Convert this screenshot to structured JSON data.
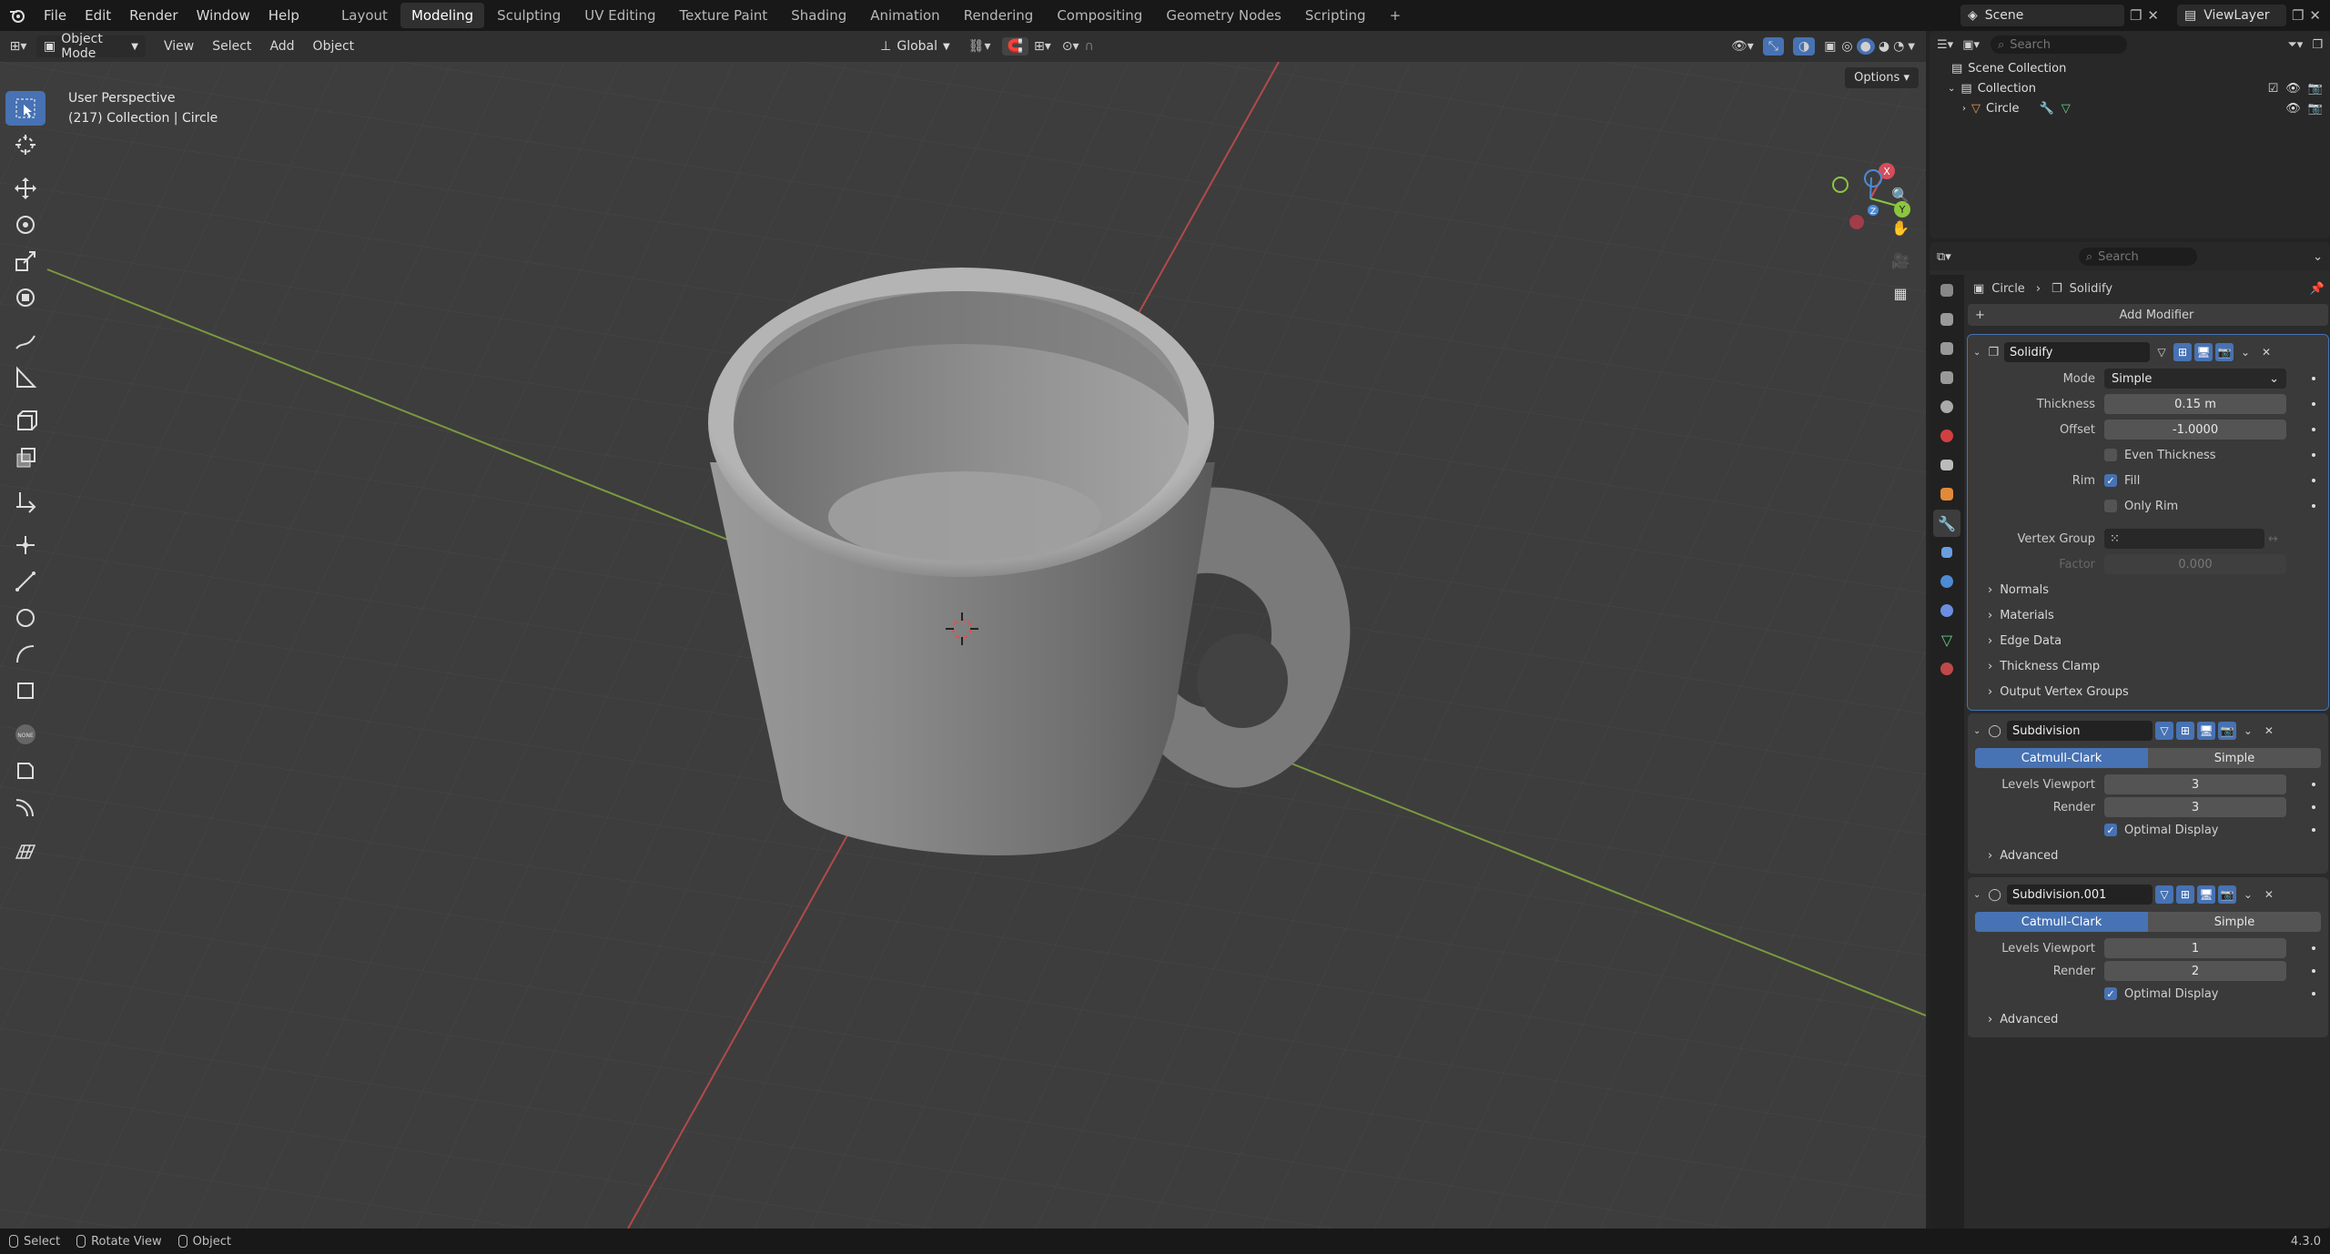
{
  "topbar": {
    "menus": [
      "File",
      "Edit",
      "Render",
      "Window",
      "Help"
    ],
    "workspaces": [
      "Layout",
      "Modeling",
      "Sculpting",
      "UV Editing",
      "Texture Paint",
      "Shading",
      "Animation",
      "Rendering",
      "Compositing",
      "Geometry Nodes",
      "Scripting"
    ],
    "active_workspace": "Modeling",
    "scene": "Scene",
    "view_layer": "ViewLayer"
  },
  "viewport_header": {
    "mode": "Object Mode",
    "menus": [
      "View",
      "Select",
      "Add",
      "Object"
    ],
    "orientation": "Global",
    "options": "Options"
  },
  "viewport": {
    "perspective": "User Perspective",
    "collection_info": "(217) Collection | Circle",
    "gizmo": {
      "x": "X",
      "y": "Y",
      "z": "Z"
    }
  },
  "outliner": {
    "search_placeholder": "Search",
    "scene_collection": "Scene Collection",
    "collection": "Collection",
    "object": "Circle"
  },
  "properties": {
    "search_placeholder": "Search",
    "breadcrumb_object": "Circle",
    "breadcrumb_modifier": "Solidify",
    "add_modifier": "Add Modifier",
    "solidify": {
      "name": "Solidify",
      "mode_label": "Mode",
      "mode_value": "Simple",
      "thickness_label": "Thickness",
      "thickness_value": "0.15 m",
      "offset_label": "Offset",
      "offset_value": "-1.0000",
      "even_thickness": "Even Thickness",
      "rim_label": "Rim",
      "fill": "Fill",
      "only_rim": "Only Rim",
      "vertex_group_label": "Vertex Group",
      "factor_label": "Factor",
      "factor_value": "0.000",
      "subpanels": [
        "Normals",
        "Materials",
        "Edge Data",
        "Thickness Clamp",
        "Output Vertex Groups"
      ]
    },
    "subdivision": {
      "name": "Subdivision",
      "catmull": "Catmull-Clark",
      "simple": "Simple",
      "levels_label": "Levels Viewport",
      "levels_value": "3",
      "render_label": "Render",
      "render_value": "3",
      "optimal": "Optimal Display",
      "advanced": "Advanced"
    },
    "subdivision2": {
      "name": "Subdivision.001",
      "catmull": "Catmull-Clark",
      "simple": "Simple",
      "levels_label": "Levels Viewport",
      "levels_value": "1",
      "render_label": "Render",
      "render_value": "2",
      "optimal": "Optimal Display",
      "advanced": "Advanced"
    }
  },
  "status": {
    "select": "Select",
    "rotate": "Rotate View",
    "object": "Object",
    "version": "4.3.0"
  },
  "colors": {
    "accent": "#4772b3",
    "x_axis": "#d44d5b",
    "y_axis": "#8cc63e",
    "z_axis": "#4d8bd4"
  }
}
